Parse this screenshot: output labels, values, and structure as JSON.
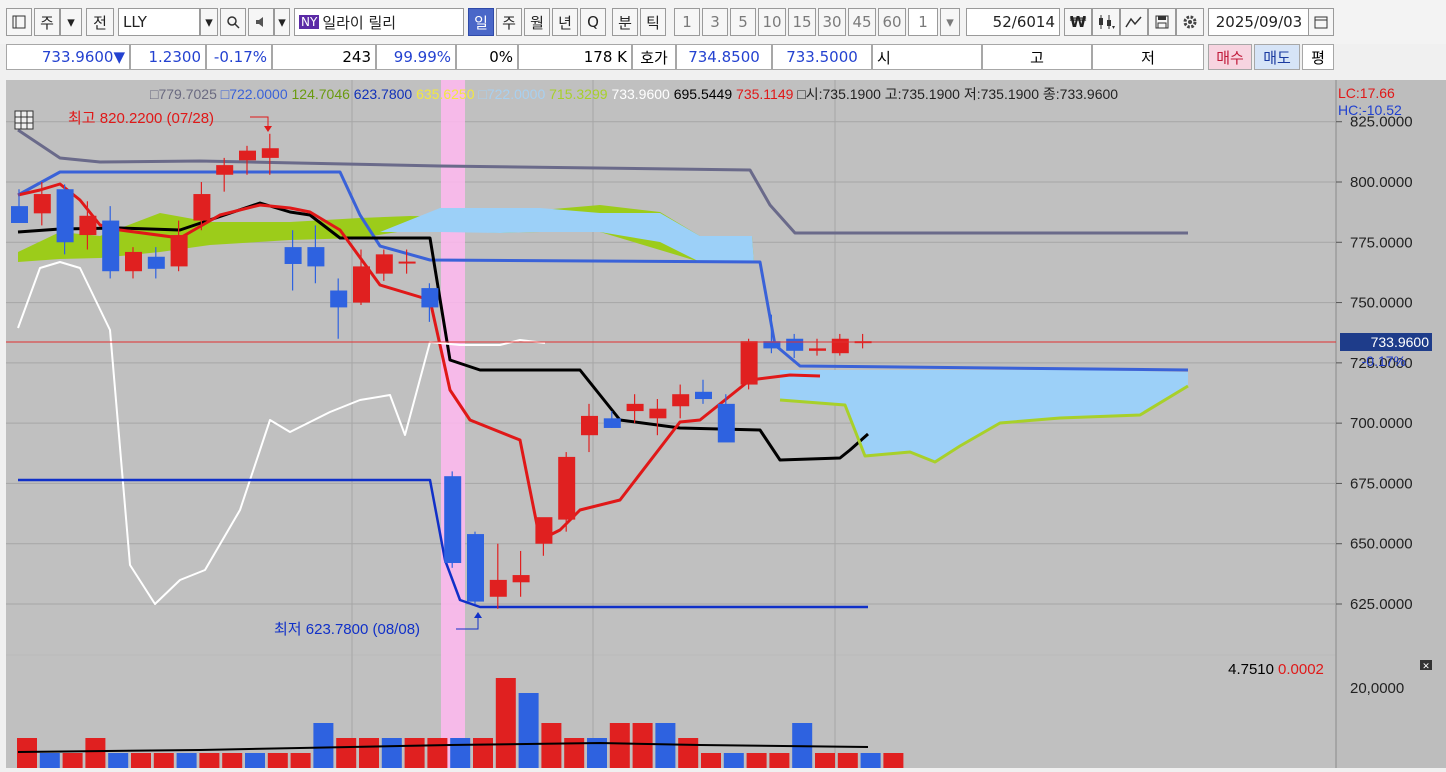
{
  "toolbar": {
    "btn_ju": "주",
    "btn_jeon": "전",
    "symbol": "LLY",
    "exchange_badge": "NY",
    "stock_name": "일라이 릴리",
    "periods": [
      "일",
      "주",
      "월",
      "년",
      "Q",
      "분",
      "틱"
    ],
    "active_period": "일",
    "intervals": [
      "1",
      "3",
      "5",
      "10",
      "15",
      "30",
      "45",
      "60"
    ],
    "count_value": "1",
    "position": "52",
    "total": "/6014",
    "date": "2025/09/03"
  },
  "quote": {
    "price": "733.9600",
    "arrow": "▼",
    "change": "1.2300",
    "change_pct": "-0.17%",
    "volume": "243",
    "ratio": "99.99%",
    "zero_pct": "0%",
    "amount": "178 K",
    "hoga_label": "호가",
    "ask": "734.8500",
    "bid": "733.5000",
    "open_label": "시",
    "high_label": "고",
    "low_label": "저",
    "buy_label": "매수",
    "sell_label": "매도",
    "avg_label": "평"
  },
  "legend": {
    "items": [
      {
        "text": "779.7025",
        "color": "#6a6a80",
        "marker": "□"
      },
      {
        "text": "722.0000",
        "color": "#3a62d8",
        "marker": "□"
      },
      {
        "text": "124.7046",
        "color": "#6a9a10",
        "marker": ""
      },
      {
        "text": "623.7800",
        "color": "#1030b8",
        "marker": ""
      },
      {
        "text": "635.6250",
        "color": "#f2e840",
        "marker": ""
      },
      {
        "text": "722.0000",
        "color": "#a8d0f0",
        "marker": "□"
      },
      {
        "text": "715.3299",
        "color": "#a8d02a",
        "marker": ""
      },
      {
        "text": "733.9600",
        "color": "#ffffff",
        "marker": ""
      },
      {
        "text": "695.5449",
        "color": "#000000",
        "marker": ""
      },
      {
        "text": "735.1149",
        "color": "#e01818",
        "marker": ""
      }
    ],
    "ohlc": "□시:735.1900 고:735.1900 저:735.1900 종:733.9600"
  },
  "side": {
    "lc": "LC:17.66",
    "hc": "HC:-10.52"
  },
  "annotations": {
    "high": "최고 820.2200 (07/28)",
    "low": "최저 623.7800 (08/08)"
  },
  "price_label": {
    "price": "733.9600",
    "pct": "-0.17%"
  },
  "volume_panel": {
    "value1": "4.7510",
    "value2": "0.0002",
    "axis_label": "20,0000"
  },
  "colors": {
    "up": "#e02020",
    "down": "#2e62e0",
    "chart_bg": "#c0c0c0",
    "highlight": "#ffb8f0"
  },
  "chart_data": {
    "type": "candlestick",
    "y_ticks": [
      "825.0000",
      "800.0000",
      "775.0000",
      "750.0000",
      "725.0000",
      "700.0000",
      "675.0000",
      "650.0000",
      "625.0000"
    ],
    "ylim": [
      606,
      835
    ],
    "candles": [
      {
        "o": 790,
        "h": 797,
        "l": 785,
        "c": 783
      },
      {
        "o": 787,
        "h": 800,
        "l": 782,
        "c": 795
      },
      {
        "o": 797,
        "h": 799,
        "l": 770,
        "c": 775
      },
      {
        "o": 778,
        "h": 792,
        "l": 772,
        "c": 786
      },
      {
        "o": 784,
        "h": 790,
        "l": 760,
        "c": 763
      },
      {
        "o": 763,
        "h": 773,
        "l": 760,
        "c": 771
      },
      {
        "o": 769,
        "h": 773,
        "l": 760,
        "c": 764
      },
      {
        "o": 765,
        "h": 784,
        "l": 763,
        "c": 778
      },
      {
        "o": 784,
        "h": 800,
        "l": 780,
        "c": 795
      },
      {
        "o": 803,
        "h": 810,
        "l": 796,
        "c": 807
      },
      {
        "o": 809,
        "h": 815,
        "l": 803,
        "c": 813
      },
      {
        "o": 810,
        "h": 820,
        "l": 803,
        "c": 814
      },
      {
        "o": 773,
        "h": 780,
        "l": 755,
        "c": 766
      },
      {
        "o": 773,
        "h": 782,
        "l": 758,
        "c": 765
      },
      {
        "o": 755,
        "h": 760,
        "l": 735,
        "c": 748
      },
      {
        "o": 750,
        "h": 772,
        "l": 749,
        "c": 765
      },
      {
        "o": 762,
        "h": 772,
        "l": 759,
        "c": 770
      },
      {
        "o": 767,
        "h": 772,
        "l": 762,
        "c": 767
      },
      {
        "o": 756,
        "h": 758,
        "l": 742,
        "c": 748
      },
      {
        "o": 678,
        "h": 680,
        "l": 640,
        "c": 642
      },
      {
        "o": 654,
        "h": 655,
        "l": 625,
        "c": 626
      },
      {
        "o": 628,
        "h": 650,
        "l": 623,
        "c": 635
      },
      {
        "o": 634,
        "h": 647,
        "l": 628,
        "c": 637
      },
      {
        "o": 650,
        "h": 660,
        "l": 645,
        "c": 661
      },
      {
        "o": 660,
        "h": 688,
        "l": 655,
        "c": 686
      },
      {
        "o": 695,
        "h": 708,
        "l": 688,
        "c": 703
      },
      {
        "o": 702,
        "h": 705,
        "l": 698,
        "c": 698
      },
      {
        "o": 705,
        "h": 712,
        "l": 700,
        "c": 708
      },
      {
        "o": 702,
        "h": 710,
        "l": 695,
        "c": 706
      },
      {
        "o": 707,
        "h": 716,
        "l": 702,
        "c": 712
      },
      {
        "o": 713,
        "h": 718,
        "l": 708,
        "c": 710
      },
      {
        "o": 708,
        "h": 712,
        "l": 693,
        "c": 692
      },
      {
        "o": 716,
        "h": 735,
        "l": 714,
        "c": 734
      },
      {
        "o": 734,
        "h": 745,
        "l": 729,
        "c": 731
      },
      {
        "o": 735,
        "h": 737,
        "l": 727,
        "c": 730
      },
      {
        "o": 730,
        "h": 735,
        "l": 728,
        "c": 731
      },
      {
        "o": 729,
        "h": 737,
        "l": 728,
        "c": 735
      },
      {
        "o": 734,
        "h": 737,
        "l": 731,
        "c": 734
      }
    ],
    "volume": [
      2,
      1,
      1,
      2,
      1,
      1,
      1,
      1,
      1,
      1,
      1,
      1,
      1,
      3,
      2,
      2,
      2,
      2,
      2,
      2,
      2,
      6,
      5,
      3,
      2,
      2,
      3,
      3,
      3,
      2,
      1,
      1,
      1,
      1,
      3,
      1,
      1,
      1,
      1
    ],
    "ichimoku": {
      "tenkan": [
        775,
        777,
        779,
        780,
        779,
        781,
        780,
        780,
        781,
        781,
        784,
        787,
        785,
        782,
        781,
        773,
        772,
        772,
        772,
        702,
        698,
        694,
        690,
        664,
        658,
        656,
        663,
        668,
        675,
        682,
        695,
        702,
        703,
        701,
        701,
        723,
        722,
        724,
        731,
        736
      ],
      "kijun": [
        777,
        779,
        781,
        781,
        781,
        781,
        781,
        781,
        781,
        781,
        781,
        781,
        781,
        781,
        781,
        778,
        776,
        776,
        776,
        712,
        713,
        713,
        713,
        713,
        713,
        713,
        713,
        713,
        713,
        713,
        713,
        703,
        693,
        686,
        686,
        687,
        688,
        695
      ],
      "chikou": [
        765,
        770,
        768,
        766,
        755,
        720,
        700,
        660,
        640,
        645,
        672,
        698,
        700,
        705,
        706,
        712,
        716,
        700,
        722
      ]
    }
  }
}
